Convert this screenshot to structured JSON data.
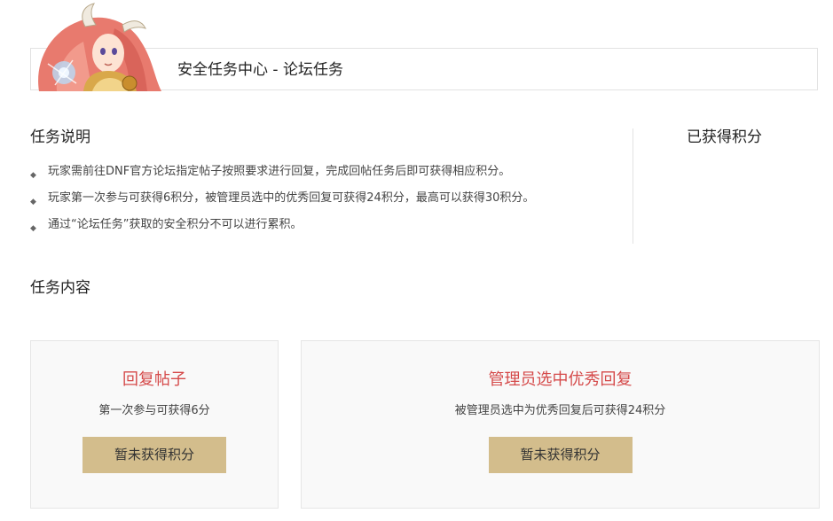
{
  "header": {
    "title": "安全任务中心 - 论坛任务"
  },
  "mascot": {
    "icon": "anime-character-portrait-icon"
  },
  "task_description": {
    "heading": "任务说明",
    "items": [
      "玩家需前往DNF官方论坛指定帖子按照要求进行回复，完成回帖任务后即可获得相应积分。",
      "玩家第一次参与可获得6积分，被管理员选中的优秀回复可获得24积分，最高可以获得30积分。",
      "通过“论坛任务”获取的安全积分不可以进行累积。"
    ],
    "bullet_icon": "diamond-bullet-icon"
  },
  "points_earned": {
    "heading": "已获得积分"
  },
  "task_content": {
    "heading": "任务内容",
    "cards": [
      {
        "title": "回复帖子",
        "desc": "第一次参与可获得6分",
        "button": "暂未获得积分"
      },
      {
        "title": "管理员选中优秀回复",
        "desc": "被管理员选中为优秀回复后可获得24积分",
        "button": "暂未获得积分"
      }
    ]
  },
  "colors": {
    "accent_red": "#d54a4a",
    "button_gold": "#d3bd8c",
    "border": "#e2e2e2"
  }
}
